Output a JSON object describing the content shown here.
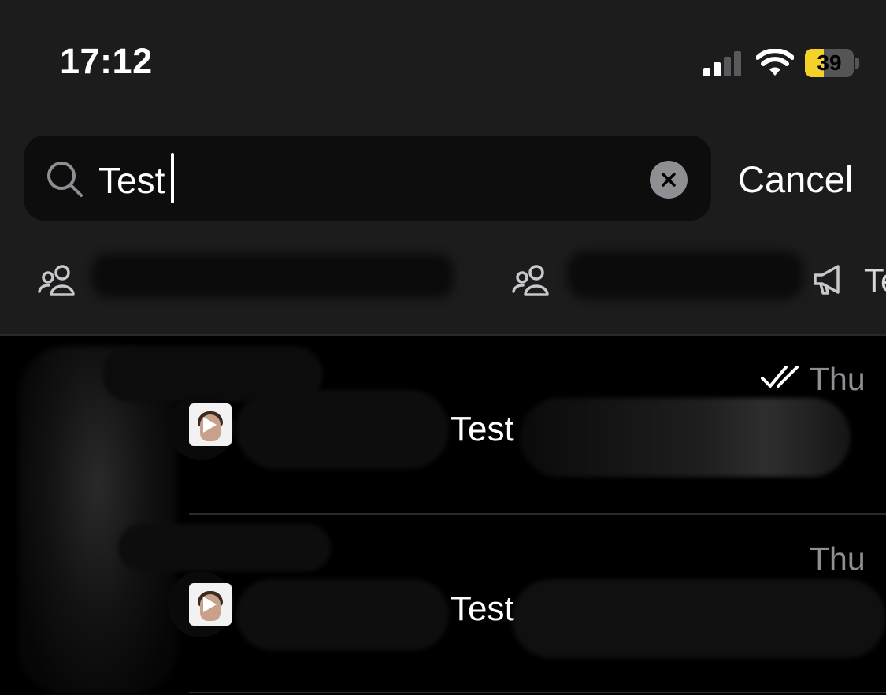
{
  "status_bar": {
    "time": "17:12",
    "battery": "39",
    "battery_fraction": 0.39,
    "icons": [
      "cellular-signal-icon",
      "wifi-icon",
      "battery-icon"
    ]
  },
  "search": {
    "query": "Test",
    "cancel_label": "Cancel",
    "icons": [
      "search-icon",
      "clear-icon"
    ]
  },
  "filters": {
    "items": [
      {
        "icon": "group-icon",
        "label": ""
      },
      {
        "icon": "group-icon",
        "label": ""
      },
      {
        "icon": "megaphone-icon",
        "label": "Te"
      }
    ]
  },
  "results": [
    {
      "snippet": "Test",
      "date": "Thu",
      "read_receipt": "double-check-icon"
    },
    {
      "snippet": "Test",
      "date": "Thu"
    }
  ],
  "colors": {
    "background": "#000000",
    "header": "#1c1c1d",
    "secondary_text": "#8e8e93",
    "battery_accent": "#f5d22a"
  }
}
